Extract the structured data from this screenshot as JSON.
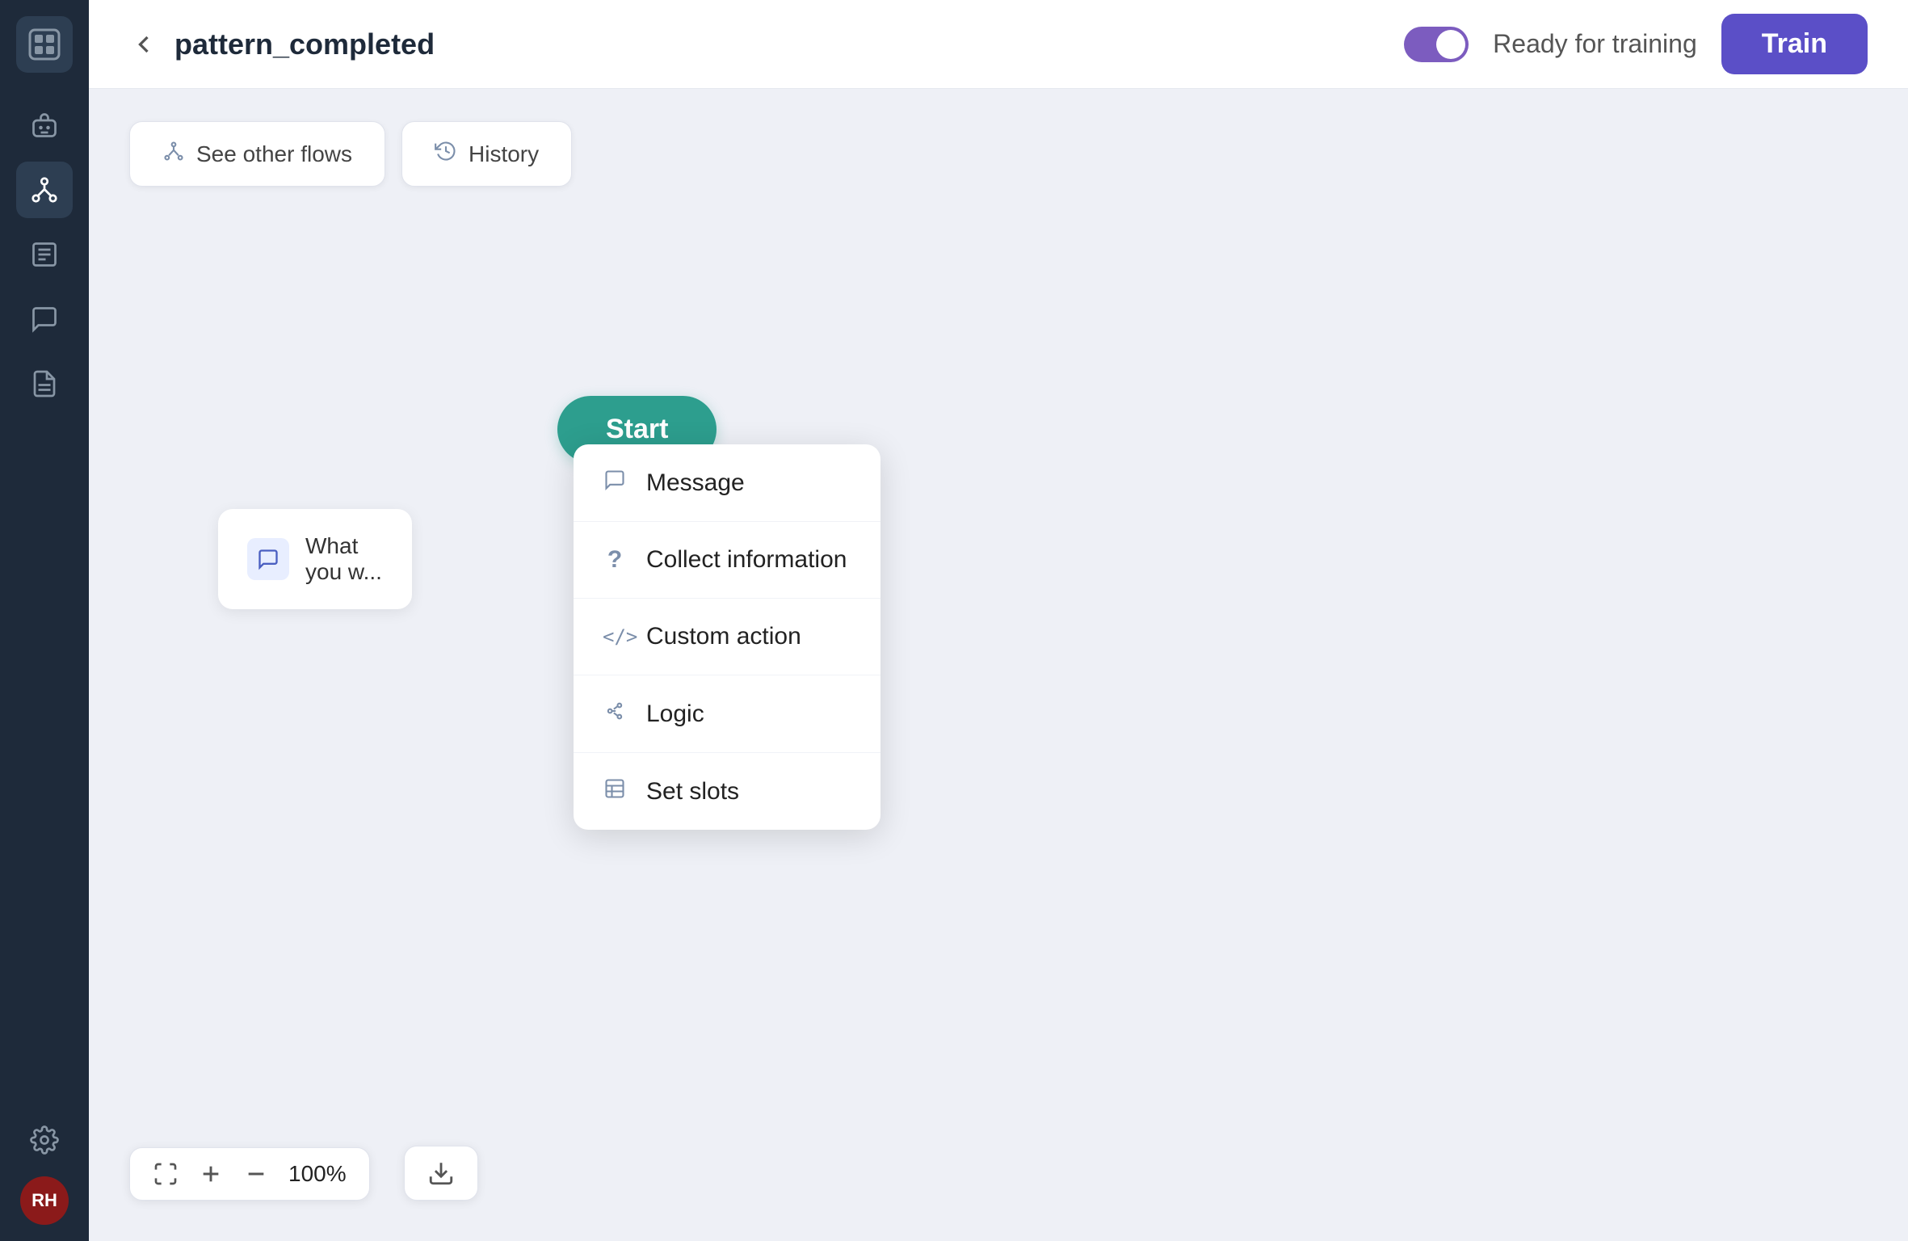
{
  "sidebar": {
    "logo_initials": "",
    "items": [
      {
        "id": "bot",
        "label": "bot"
      },
      {
        "id": "flows",
        "label": "flows",
        "active": true
      },
      {
        "id": "content",
        "label": "content"
      },
      {
        "id": "conversations",
        "label": "conversations"
      },
      {
        "id": "documents",
        "label": "documents"
      }
    ],
    "bottom": [
      {
        "id": "settings",
        "label": "settings"
      }
    ],
    "avatar": "RH"
  },
  "header": {
    "back_label": "←",
    "title": "pattern_completed",
    "ready_label": "Ready for training",
    "train_label": "Train"
  },
  "toolbar": {
    "see_other_flows_label": "See other flows",
    "history_label": "History"
  },
  "canvas": {
    "start_label": "Start",
    "what_card_text": "What you w...",
    "dropdown": {
      "items": [
        {
          "id": "message",
          "label": "Message",
          "icon": "💬"
        },
        {
          "id": "collect-information",
          "label": "Collect information",
          "icon": "?"
        },
        {
          "id": "custom-action",
          "label": "Custom action",
          "icon": "</>"
        },
        {
          "id": "logic",
          "label": "Logic",
          "icon": "⑃"
        },
        {
          "id": "set-slots",
          "label": "Set slots",
          "icon": "▤"
        }
      ]
    }
  },
  "zoom": {
    "percent": "100%"
  },
  "colors": {
    "sidebar_bg": "#1e2a3a",
    "active_item_bg": "#2d3e52",
    "train_btn": "#5b4fc7",
    "toggle_bg": "#7c5cbf",
    "start_node": "#2d9e8e"
  }
}
